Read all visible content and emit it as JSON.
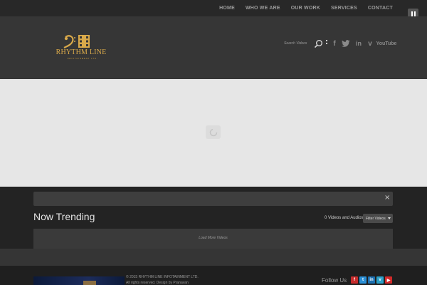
{
  "nav": {
    "items": [
      "HOME",
      "WHO WE ARE",
      "OUR WORK",
      "SERVICES",
      "CONTACT"
    ]
  },
  "header": {
    "logo_name": "RHYTHM LINE",
    "logo_sub": "INFOTAINMENT LTD.",
    "search_placeholder": "Search Videos",
    "social": {
      "facebook": "f",
      "linkedin": "in",
      "vimeo": "v",
      "youtube": "YouTube"
    }
  },
  "trending": {
    "close": "×",
    "title": "Now Trending",
    "count": "0 Videos and Audios",
    "filter": "Filter Videos",
    "load_more": "Load More Videos"
  },
  "footer": {
    "copyright": "© 2015 RHYTHM LINE INFOTAINMENT LTD.",
    "rights": "All rights reserved. Design by Pranavan",
    "follow": "Follow Us",
    "social": [
      "f",
      "t",
      "in",
      "v",
      "▶"
    ]
  },
  "colors": {
    "accent_gold": "#d9a94a",
    "footer_social": [
      "#c62c2c",
      "#2a8fd6",
      "#1c6fb0",
      "#2aa0c8",
      "#d22a2a"
    ]
  }
}
